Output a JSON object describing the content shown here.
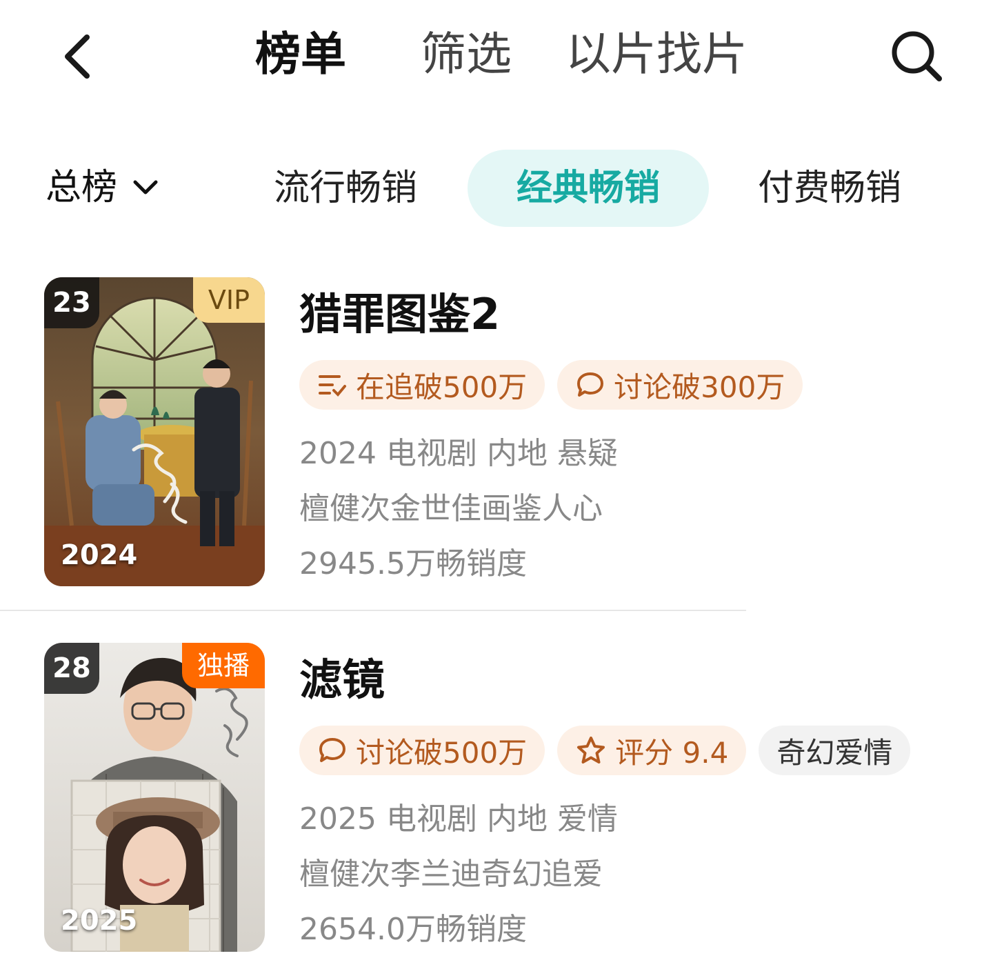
{
  "nav": {
    "tabs": [
      "榜单",
      "筛选",
      "以片找片"
    ],
    "active_tab": "榜单"
  },
  "categories": {
    "dropdown_label": "总榜",
    "tabs": [
      "流行畅销",
      "经典畅销",
      "付费畅销"
    ],
    "selected": "经典畅销"
  },
  "items": [
    {
      "rank": "23",
      "badge": "VIP",
      "poster_year": "2024",
      "title": "猎罪图鉴2",
      "tags": [
        {
          "icon": "follow-list-icon",
          "label": "在追破500万"
        },
        {
          "icon": "comment-icon",
          "label": "讨论破300万"
        }
      ],
      "info": "2024 电视剧 内地 悬疑",
      "description": "檀健次金世佳画鉴人心",
      "sales": "2945.5万畅销度"
    },
    {
      "rank": "28",
      "badge": "独播",
      "poster_year": "2025",
      "title": "滤镜",
      "tags": [
        {
          "icon": "comment-icon",
          "label": "讨论破500万"
        },
        {
          "icon": "star-icon",
          "label": "评分 9.4"
        }
      ],
      "genre_tag": "奇幻爱情",
      "info": "2025 电视剧 内地 爱情",
      "description": "檀健次李兰迪奇幻追爱",
      "sales": "2654.0万畅销度"
    }
  ],
  "colors": {
    "accent": "#17aaa2",
    "accent_bg": "#e4f7f6",
    "tag_orange_text": "#b35a1f",
    "tag_orange_bg": "#fdf0e6",
    "vip_badge": "#f7d78e",
    "exclusive_badge": "#ff6a00"
  }
}
